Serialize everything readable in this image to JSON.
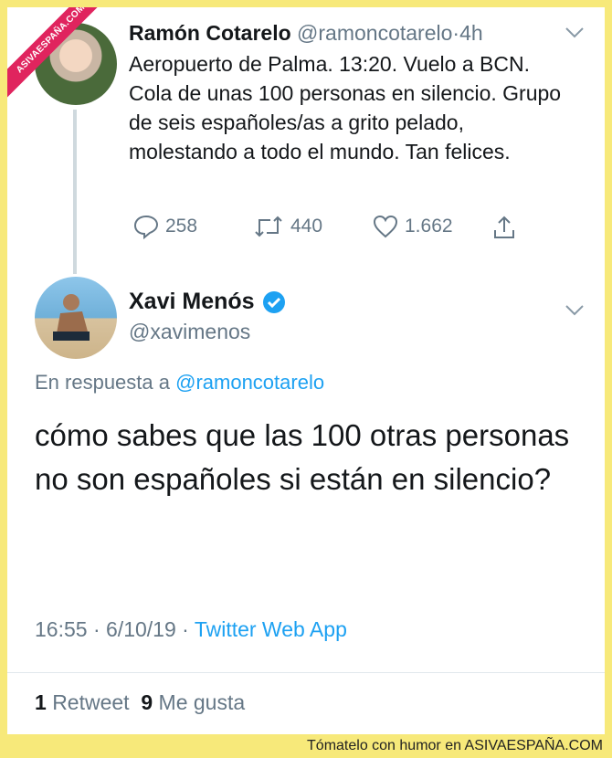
{
  "watermark": {
    "ribbon": "ASIVAESPAÑA.COM",
    "footer": "Tómatelo con humor en ASIVAESPAÑA.COM"
  },
  "tweet1": {
    "name": "Ramón Cotarelo",
    "handle": "@ramoncotarelo",
    "separator": "·",
    "time": "4h",
    "text": "Aeropuerto de Palma. 13:20. Vuelo a BCN. Cola de unas 100 personas en silencio. Grupo de seis españoles/as a grito pelado, molestando a todo el mundo. Tan felices.",
    "replies": "258",
    "retweets": "440",
    "likes": "1.662"
  },
  "tweet2": {
    "name": "Xavi Menós",
    "handle": "@xavimenos",
    "reply_prefix": "En respuesta a ",
    "reply_handle": "@ramoncotarelo",
    "text": "cómo sabes que las 100 otras personas no son españoles si están en silencio?",
    "time": "16:55",
    "date_sep": "·",
    "date": "6/10/19",
    "source_sep": "·",
    "source": "Twitter Web App",
    "retweet_count": "1",
    "retweet_label": "Retweet",
    "like_count": "9",
    "like_label": "Me gusta"
  },
  "colors": {
    "accent": "#1da1f2",
    "muted": "#657786",
    "text": "#14171a",
    "frame": "#f7e97a"
  },
  "icons": [
    "reply-icon",
    "retweet-icon",
    "like-icon",
    "share-icon",
    "chevron-down-icon",
    "verified-badge-icon"
  ]
}
